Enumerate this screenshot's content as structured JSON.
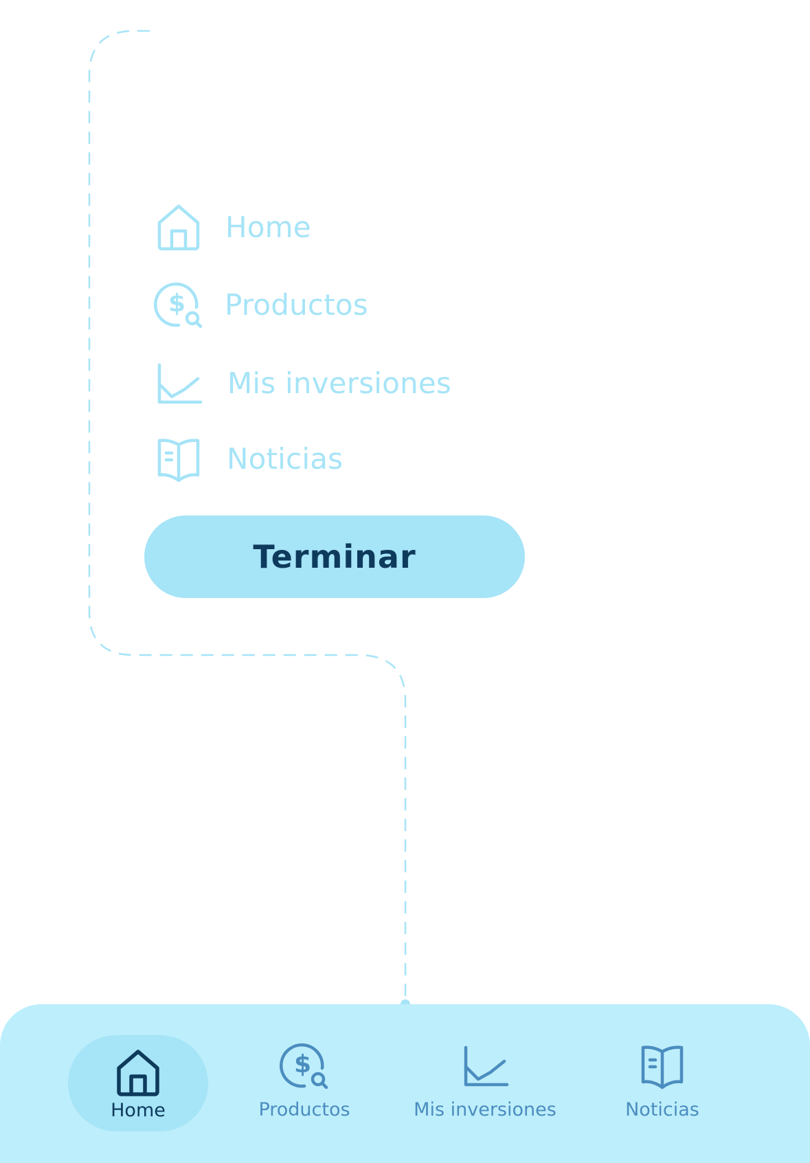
{
  "colors": {
    "faded_accent": "#a6e4f7",
    "nav_background": "#bdeefb",
    "nav_inactive": "#4b8dbf",
    "nav_active": "#0e3a5c",
    "dashed_guide": "#a6e4f7"
  },
  "tutorial_menu": {
    "items": [
      {
        "label": "Home",
        "icon": "home-icon"
      },
      {
        "label": "Productos",
        "icon": "dollar-search-icon"
      },
      {
        "label": "Mis inversiones",
        "icon": "line-chart-icon"
      },
      {
        "label": "Noticias",
        "icon": "open-book-icon"
      }
    ],
    "finish_label": "Terminar"
  },
  "bottom_nav": {
    "active": "Home",
    "items": [
      {
        "label": "Home",
        "icon": "home-icon"
      },
      {
        "label": "Productos",
        "icon": "dollar-search-icon"
      },
      {
        "label": "Mis inversiones",
        "icon": "line-chart-icon"
      },
      {
        "label": "Noticias",
        "icon": "open-book-icon"
      }
    ]
  }
}
